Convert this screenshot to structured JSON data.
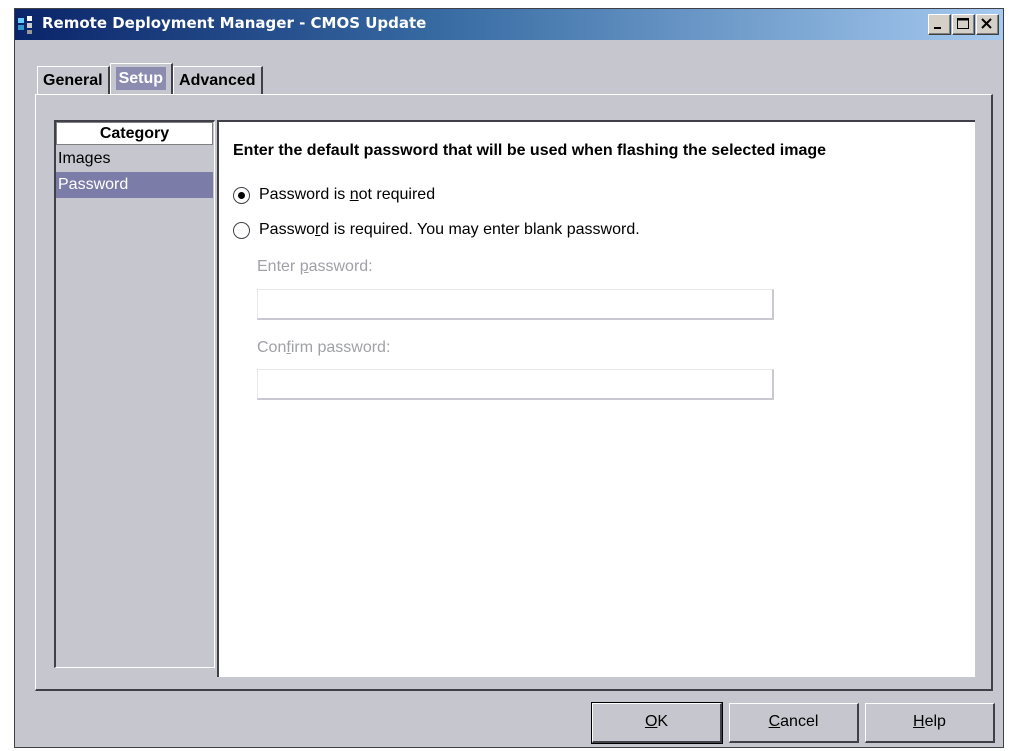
{
  "window": {
    "title": "Remote Deployment Manager - CMOS Update",
    "controls": {
      "minimize": "minimize-icon",
      "restore": "restore-icon",
      "close": "close-icon"
    }
  },
  "tabs": [
    {
      "label": "General",
      "active": false
    },
    {
      "label": "Setup",
      "active": true
    },
    {
      "label": "Advanced",
      "active": false
    }
  ],
  "sidebar": {
    "header": "Category",
    "items": [
      {
        "label": "Images",
        "selected": false
      },
      {
        "label": "Password",
        "selected": true
      }
    ]
  },
  "content": {
    "heading": "Enter the default password that will be used when flashing the selected image",
    "options": [
      {
        "pre": "Password is ",
        "mnemonic": "n",
        "post": "ot required",
        "checked": true
      },
      {
        "pre": "Passwo",
        "mnemonic": "r",
        "post": "d is required. You may enter blank password.",
        "checked": false
      }
    ],
    "enter_password": {
      "pre": "Enter ",
      "mnemonic": "p",
      "post": "assword:",
      "value": ""
    },
    "confirm_password": {
      "pre": "Con",
      "mnemonic": "f",
      "post": "irm password:",
      "value": ""
    }
  },
  "buttons": {
    "ok": {
      "mnemonic": "O",
      "post": "K"
    },
    "cancel": {
      "mnemonic": "C",
      "post": "ancel"
    },
    "help": {
      "mnemonic": "H",
      "post": "elp"
    }
  },
  "colors": {
    "titlebar_start": "#0a246a",
    "titlebar_end": "#a6caf0",
    "window_bg": "#c6c6ce",
    "selection": "#7c7ca8",
    "disabled_text": "#a0a0a8"
  }
}
